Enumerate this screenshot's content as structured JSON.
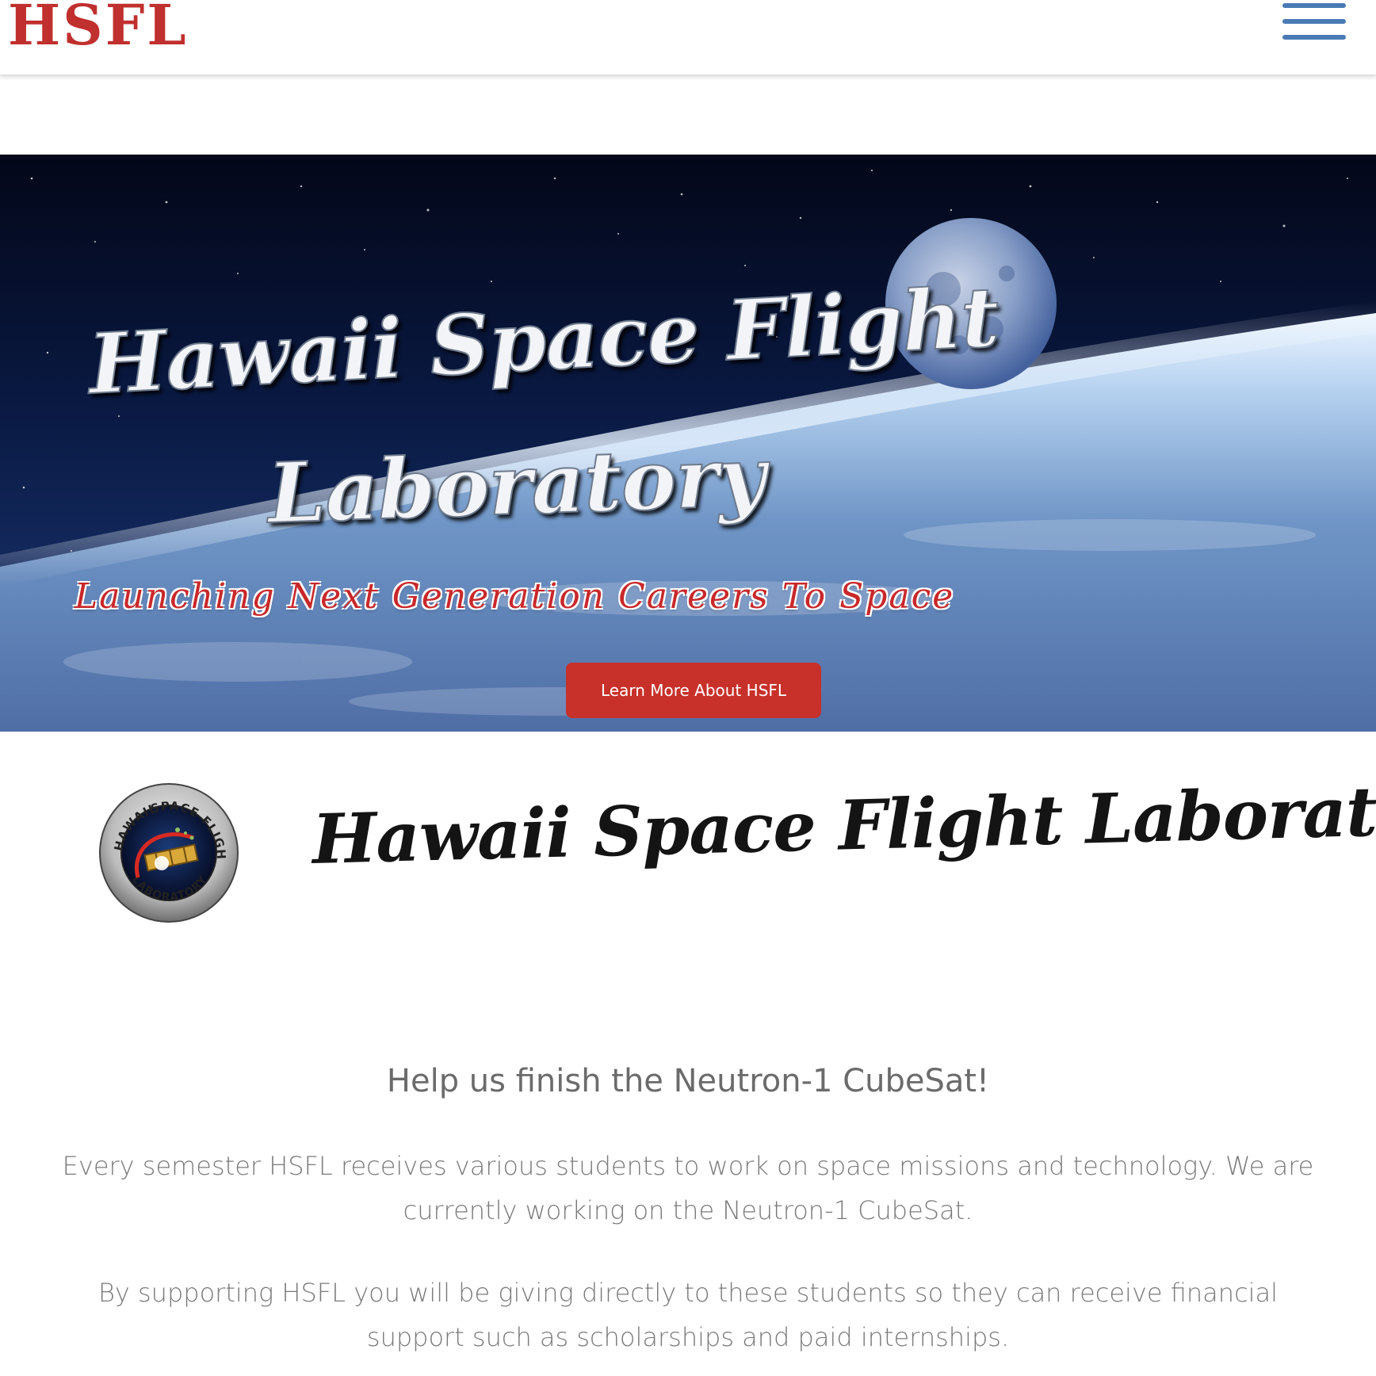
{
  "header": {
    "logo_text": "HSFL",
    "menu_icon": "hamburger-menu-icon",
    "logo_color": "#c0302e",
    "menu_color": "#4a7ab5"
  },
  "hero": {
    "title_line1": "Hawaii Space Flight",
    "title_line2": "Laboratory",
    "tagline": "Launching Next Generation Careers To Space",
    "button_label": "Learn More About HSFL",
    "button_color": "#c8302a",
    "tagline_color": "#c8282a"
  },
  "section": {
    "logo": {
      "arc_top": "SPACE FLIGHT",
      "arc_left": "HAWAII",
      "arc_bottom": "LABORATORY"
    },
    "title": "Hawaii Space Flight Laboratory"
  },
  "content": {
    "heading": "Help us finish the Neutron-1 CubeSat!",
    "paragraph1": "Every semester HSFL receives various students to work on space missions and technology. We are currently working on the Neutron-1 CubeSat.",
    "paragraph2": "By supporting HSFL you will be giving directly to these students so they can receive financial support such as scholarships and paid internships."
  }
}
